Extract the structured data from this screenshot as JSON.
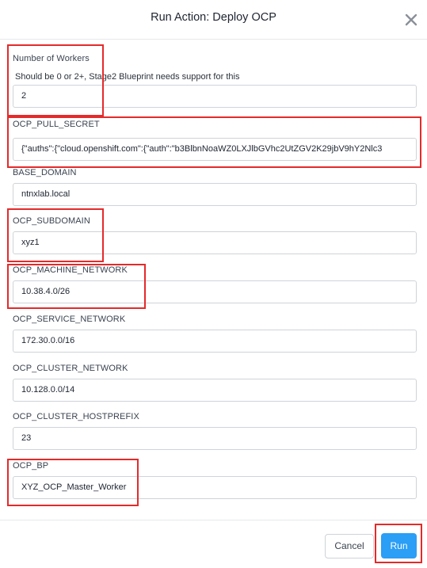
{
  "dialog": {
    "title": "Run Action: Deploy OCP"
  },
  "fields": [
    {
      "label": "Number of Workers",
      "help": "Should be 0 or 2+, Stage2 Blueprint needs support for this",
      "value": "2"
    },
    {
      "label": "OCP_PULL_SECRET",
      "value": "{\"auths\":{\"cloud.openshift.com\":{\"auth\":\"b3BlbnNoaWZ0LXJlbGVhc2UtZGV2K29jbV9hY2Nlc3"
    },
    {
      "label": "BASE_DOMAIN",
      "value": "ntnxlab.local"
    },
    {
      "label": "OCP_SUBDOMAIN",
      "value": "xyz1"
    },
    {
      "label": "OCP_MACHINE_NETWORK",
      "value": "10.38.4.0/26"
    },
    {
      "label": "OCP_SERVICE_NETWORK",
      "value": "172.30.0.0/16"
    },
    {
      "label": "OCP_CLUSTER_NETWORK",
      "value": "10.128.0.0/14"
    },
    {
      "label": "OCP_CLUSTER_HOSTPREFIX",
      "value": "23"
    },
    {
      "label": "OCP_BP",
      "value": "XYZ_OCP_Master_Worker"
    }
  ],
  "footer": {
    "cancel_label": "Cancel",
    "run_label": "Run"
  },
  "colors": {
    "primary": "#2b9ef5",
    "highlight": "#e52a2a"
  }
}
